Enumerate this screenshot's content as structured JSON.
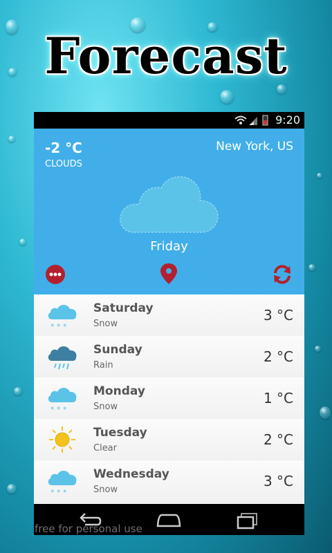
{
  "banner": {
    "title": "Forecast"
  },
  "status_bar": {
    "time": "9:20"
  },
  "current": {
    "temperature": "-2 °C",
    "condition": "CLOUDS",
    "location": "New York, US",
    "day": "Friday"
  },
  "actions": {
    "menu_icon": "more-icon",
    "location_icon": "map-pin-icon",
    "refresh_icon": "refresh-icon"
  },
  "forecast": [
    {
      "day": "Saturday",
      "condition": "Snow",
      "temp": "3 °C",
      "icon": "snow-icon"
    },
    {
      "day": "Sunday",
      "condition": "Rain",
      "temp": "2 °C",
      "icon": "rain-icon"
    },
    {
      "day": "Monday",
      "condition": "Snow",
      "temp": "1 °C",
      "icon": "snow-icon"
    },
    {
      "day": "Tuesday",
      "condition": "Clear",
      "temp": "2 °C",
      "icon": "sun-icon"
    },
    {
      "day": "Wednesday",
      "condition": "Snow",
      "temp": "3 °C",
      "icon": "snow-icon"
    }
  ],
  "watermark": "free for personal use",
  "colors": {
    "hero": "#41aee9",
    "accent_red": "#b3202d",
    "cloud": "#5cc3e8"
  }
}
